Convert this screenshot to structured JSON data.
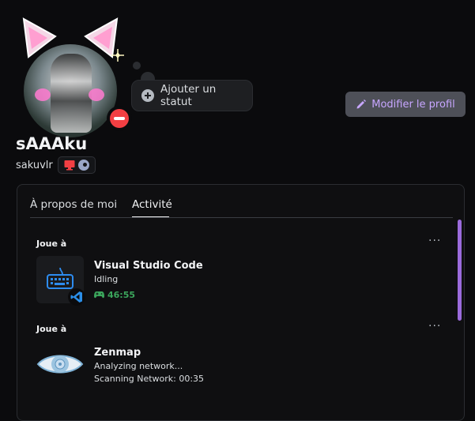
{
  "profile": {
    "display_name": "sAAAku",
    "username": "sakuvlr",
    "status": "do-not-disturb",
    "platform_icons": [
      "desktop-icon",
      "steam-icon"
    ]
  },
  "status_button": {
    "label": "Ajouter un statut",
    "icon": "plus-icon"
  },
  "edit_button": {
    "label": "Modifier le profil",
    "icon": "pencil-icon"
  },
  "tabs": [
    {
      "label": "À propos de moi",
      "active": false
    },
    {
      "label": "Activité",
      "active": true
    }
  ],
  "activities": [
    {
      "section": "Joue à",
      "name": "Visual Studio Code",
      "details": [
        "Idling"
      ],
      "timer": "46:55",
      "icon": "keyboard-icon",
      "badge_icon": "vscode-icon"
    },
    {
      "section": "Joue à",
      "name": "Zenmap",
      "details": [
        "Analyzing network...",
        "Scanning Network: 00:35"
      ],
      "icon": "eye-icon"
    }
  ],
  "colors": {
    "background": "#0b0b0d",
    "accent": "#c7a6ff",
    "dnd": "#f23f43",
    "playing_green": "#3ba55c",
    "scrollbar": "#9b6bdc"
  }
}
